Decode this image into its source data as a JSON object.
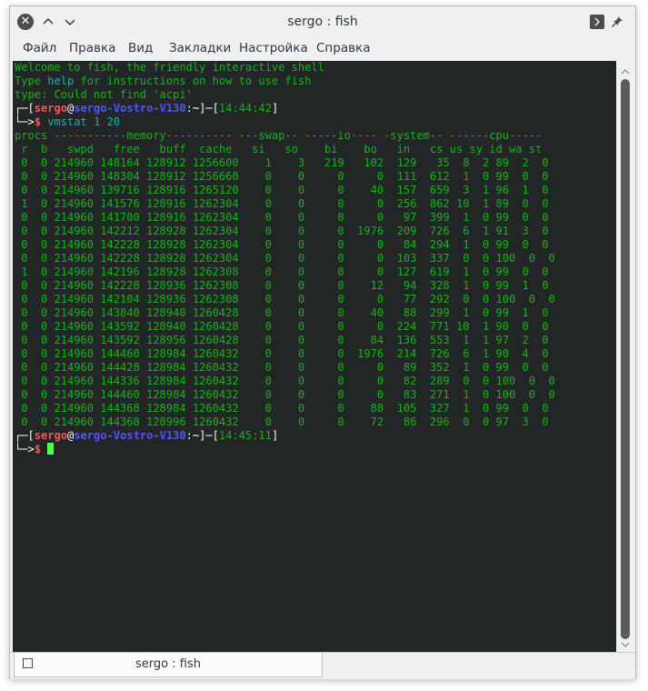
{
  "window": {
    "title": "sergo : fish"
  },
  "menu": [
    "Файл",
    "Правка",
    "Вид",
    "Закладки",
    "Настройка",
    "Справка"
  ],
  "terminal": {
    "welcome": "Welcome to fish, the friendly interactive shell",
    "help_pre": "Type ",
    "help_word": "help",
    "help_post": " for instructions on how to use fish",
    "error_line": "type: Could not find 'acpi'",
    "prompt1": {
      "user": "sergo",
      "host": "sergo-Vostro-V130",
      "path": "~",
      "time": "14:44:42"
    },
    "command": "vmstat",
    "args": "1 20",
    "header1": "procs -----------memory---------- ---swap-- -----io---- -system-- ------cpu-----",
    "header2": " r  b   swpd   free   buff  cache   si   so    bi    bo   in   cs us sy id wa st",
    "rows": [
      " 0  0 214960 148164 128912 1256600    1    3   219   102  129   35  8  2 89  2  0",
      " 0  0 214960 148304 128912 1256660    0    0     0     0  111  612  1  0 99  0  0",
      " 0  0 214960 139716 128916 1265120    0    0     0    40  157  659  3  1 96  1  0",
      " 1  0 214960 141576 128916 1262304    0    0     0     0  256  862 10  1 89  0  0",
      " 0  0 214960 141700 128916 1262304    0    0     0     0   97  399  1  0 99  0  0",
      " 0  0 214960 142212 128928 1262304    0    0     0  1976  209  726  6  1 91  3  0",
      " 0  0 214960 142228 128928 1262304    0    0     0     0   84  294  1  0 99  0  0",
      " 0  0 214960 142228 128928 1262304    0    0     0     0  103  337  0  0 100  0  0",
      " 1  0 214960 142196 128928 1262308    0    0     0     0  127  619  1  0 99  0  0",
      " 0  0 214960 142228 128936 1262308    0    0     0    12   94  328  1  0 99  1  0",
      " 0  0 214960 142104 128936 1262308    0    0     0     0   77  292  0  0 100  0  0",
      " 0  0 214960 143840 128940 1260428    0    0     0    40   88  299  1  0 99  1  0",
      " 0  0 214960 143592 128940 1260428    0    0     0     0  224  771 10  1 90  0  0",
      " 0  0 214960 143592 128956 1260428    0    0     0    84  136  553  1  1 97  2  0",
      " 0  0 214960 144460 128984 1260432    0    0     0  1976  214  726  6  1 90  4  0",
      " 0  0 214960 144428 128984 1260432    0    0     0     0   89  352  1  0 99  0  0",
      " 0  0 214960 144336 128984 1260432    0    0     0     0   82  289  0  0 100  0  0",
      " 0  0 214960 144460 128984 1260432    0    0     0     0   83  271  1  0 100  0  0",
      " 0  0 214960 144368 128984 1260432    0    0     0    88  105  327  1  0 99  0  0",
      " 0  0 214960 144368 128996 1260432    0    0     0    72   86  296  0  0 97  3  0"
    ],
    "prompt2": {
      "user": "sergo",
      "host": "sergo-Vostro-V130",
      "path": "~",
      "time": "14:45:11"
    }
  },
  "tab": {
    "label": "sergo : fish"
  }
}
